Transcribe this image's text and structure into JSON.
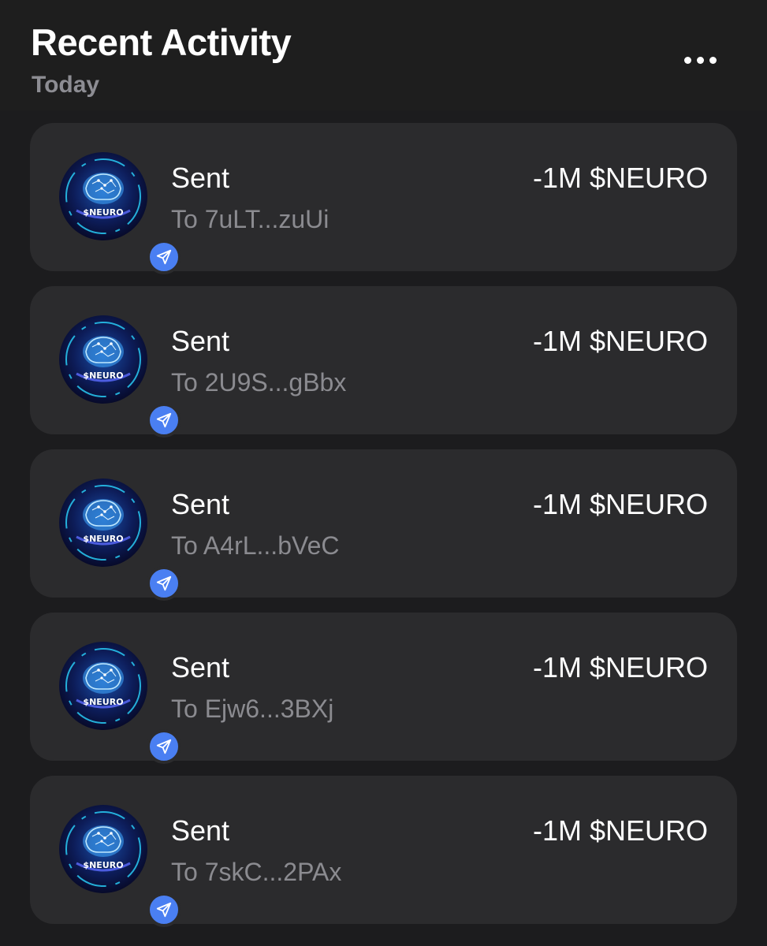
{
  "header": {
    "title": "Recent Activity",
    "section": "Today",
    "more_icon": "ellipsis-icon"
  },
  "token": {
    "logo_text": "$NEURO",
    "badge_icon": "send-arrow-icon",
    "badge_color": "#4a7ff2"
  },
  "colors": {
    "background": "#1c1c1e",
    "card": "#2b2b2d",
    "secondary_text": "#8b8b90"
  },
  "activity": [
    {
      "title": "Sent",
      "subtitle": "To 7uLT...zuUi",
      "amount": "-1M $NEURO"
    },
    {
      "title": "Sent",
      "subtitle": "To 2U9S...gBbx",
      "amount": "-1M $NEURO"
    },
    {
      "title": "Sent",
      "subtitle": "To A4rL...bVeC",
      "amount": "-1M $NEURO"
    },
    {
      "title": "Sent",
      "subtitle": "To Ejw6...3BXj",
      "amount": "-1M $NEURO"
    },
    {
      "title": "Sent",
      "subtitle": "To 7skC...2PAx",
      "amount": "-1M $NEURO"
    }
  ]
}
